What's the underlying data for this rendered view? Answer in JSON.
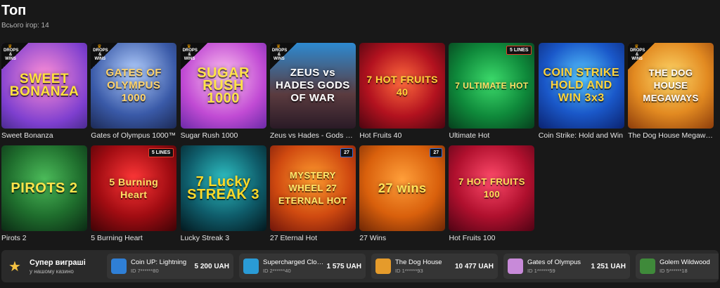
{
  "header": {
    "title": "Топ",
    "count_label": "Всього ігор: 14"
  },
  "drops_badge": "DROPS & WINS",
  "games": [
    {
      "name": "Sweet Bonanza",
      "art": "SWEET BONANZA",
      "drops": true,
      "lines": ""
    },
    {
      "name": "Gates of Olympus 1000™",
      "art": "GATES OF OLYMPUS 1000",
      "drops": true,
      "lines": ""
    },
    {
      "name": "Sugar Rush 1000",
      "art": "SUGAR RUSH 1000",
      "drops": true,
      "lines": ""
    },
    {
      "name": "Zeus vs Hades - Gods of War",
      "art": "ZEUS vs HADES GODS OF WAR",
      "drops": true,
      "lines": ""
    },
    {
      "name": "Hot Fruits 40",
      "art": "7 HOT FRUITS 40",
      "drops": false,
      "lines": ""
    },
    {
      "name": "Ultimate Hot",
      "art": "7 ULTIMATE HOT",
      "drops": false,
      "lines": "5 LINES"
    },
    {
      "name": "Coin Strike: Hold and Win",
      "art": "COIN STRIKE HOLD AND WIN 3x3",
      "drops": false,
      "lines": ""
    },
    {
      "name": "The Dog House Megaways",
      "art": "THE DOG HOUSE MEGAWAYS",
      "drops": true,
      "lines": ""
    },
    {
      "name": "Pirots 2",
      "art": "PIROTS 2",
      "drops": false,
      "lines": ""
    },
    {
      "name": "5 Burning Heart",
      "art": "5 Burning Heart",
      "drops": false,
      "lines": "5 LINES"
    },
    {
      "name": "Lucky Streak 3",
      "art": "7 Lucky STREAK 3",
      "drops": false,
      "lines": ""
    },
    {
      "name": "27 Eternal Hot",
      "art": "MYSTERY WHEEL 27 ETERNAL HOT",
      "drops": false,
      "lines": "27"
    },
    {
      "name": "27 Wins",
      "art": "27 wins",
      "drops": false,
      "lines": "27"
    },
    {
      "name": "Hot Fruits 100",
      "art": "7 HOT FRUITS 100",
      "drops": false,
      "lines": ""
    }
  ],
  "super_wins": {
    "title": "Супер виграші",
    "subtitle": "у нашому казино",
    "items": [
      {
        "game": "Coin UP: Lightning",
        "id": "ID 7******80",
        "amount": "5 200 UAH",
        "color": "#2f7fd6"
      },
      {
        "game": "Supercharged Clovers",
        "id": "ID 2******40",
        "amount": "1 575 UAH",
        "color": "#2a9bd6"
      },
      {
        "game": "The Dog House",
        "id": "ID 1******93",
        "amount": "10 477 UAH",
        "color": "#e59b2b"
      },
      {
        "game": "Gates of Olympus",
        "id": "ID 1******59",
        "amount": "1 251 UAH",
        "color": "#c88ad9"
      },
      {
        "game": "Golem Wildwood",
        "id": "ID 5******18",
        "amount": "",
        "color": "#3f8a3a"
      }
    ]
  }
}
